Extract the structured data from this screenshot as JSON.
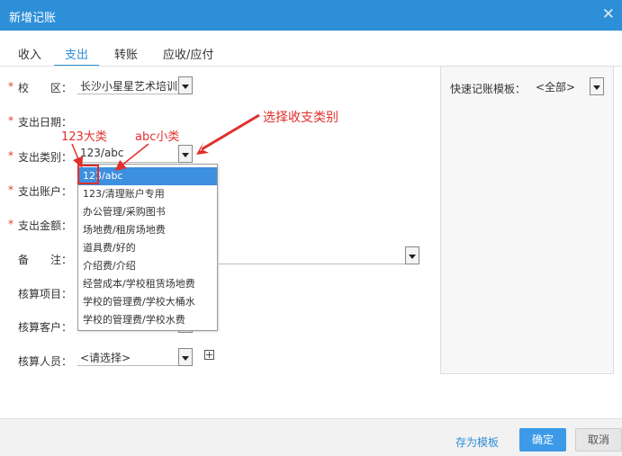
{
  "window": {
    "title": "新增记账"
  },
  "tabs": [
    {
      "label": "收入"
    },
    {
      "label": "支出"
    },
    {
      "label": "转账"
    },
    {
      "label": "应收/应付"
    }
  ],
  "form": {
    "required_mark": "*",
    "campus": {
      "label": "校　　区：",
      "value": "长沙小星星艺术培训"
    },
    "date": {
      "label": "支出日期："
    },
    "category": {
      "label": "支出类别：",
      "value": "123/abc"
    },
    "account": {
      "label": "支出账户："
    },
    "amount": {
      "label": "支出金额："
    },
    "note": {
      "label": "备　　注："
    },
    "project": {
      "label": "核算项目："
    },
    "customer": {
      "label": "核算客户："
    },
    "staff": {
      "label": "核算人员：",
      "value": "<请选择>"
    }
  },
  "dropdown": {
    "items": [
      "123/abc",
      "123/清理账户专用",
      "办公管理/采购图书",
      "场地费/租房场地费",
      "道具费/好的",
      "介绍费/介绍",
      "经营成本/学校租赁场地费",
      "学校的管理费/学校大桶水",
      "学校的管理费/学校水费"
    ]
  },
  "annotations": {
    "major": "123大类",
    "minor": "abc小类",
    "select_hint": "选择收支类别"
  },
  "quick_template": {
    "label": "快速记账模板：",
    "value": "<全部>"
  },
  "footer": {
    "save_template": "存为模板",
    "ok": "确定",
    "cancel": "取消"
  },
  "colors": {
    "accent": "#2d8fd8",
    "annotation": "#e0302c",
    "required": "#e0432b"
  }
}
